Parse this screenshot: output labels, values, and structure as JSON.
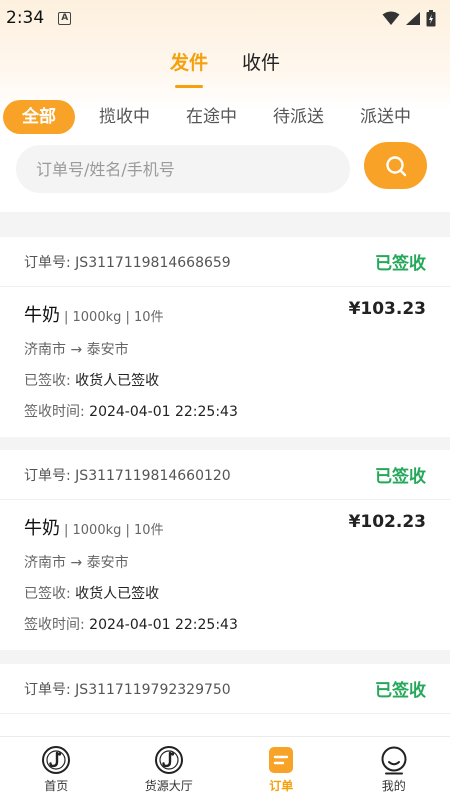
{
  "status_bar": {
    "time": "2:34",
    "notification_icon": "a-icon",
    "icons": [
      "wifi-icon",
      "signal-icon",
      "battery-icon"
    ]
  },
  "top_tabs": [
    {
      "label": "发件",
      "active": true
    },
    {
      "label": "收件",
      "active": false
    }
  ],
  "filters": [
    {
      "label": "全部",
      "active": true
    },
    {
      "label": "揽收中",
      "active": false
    },
    {
      "label": "在途中",
      "active": false
    },
    {
      "label": "待派送",
      "active": false
    },
    {
      "label": "派送中",
      "active": false
    }
  ],
  "search": {
    "placeholder": "订单号/姓名/手机号",
    "value": "",
    "button_icon": "search-icon"
  },
  "orders": [
    {
      "order_label": "订单号:",
      "order_no": "JS3117119814668659",
      "status": "已签收",
      "goods": "牛奶",
      "meta": "| 1000kg | 10件",
      "price": "¥103.23",
      "route": "济南市 → 泰安市",
      "sign_label": "已签收:",
      "sign_value": "收货人已签收",
      "time_label": "签收时间:",
      "time_value": "2024-04-01 22:25:43"
    },
    {
      "order_label": "订单号:",
      "order_no": "JS3117119814660120",
      "status": "已签收",
      "goods": "牛奶",
      "meta": "| 1000kg | 10件",
      "price": "¥102.23",
      "route": "济南市 → 泰安市",
      "sign_label": "已签收:",
      "sign_value": "收货人已签收",
      "time_label": "签收时间:",
      "time_value": "2024-04-01 22:25:43"
    },
    {
      "order_label": "订单号:",
      "order_no": "JS3117119792329750",
      "status": "已签收"
    }
  ],
  "bottom_nav": [
    {
      "label": "首页",
      "icon": "home-logo-icon",
      "active": false
    },
    {
      "label": "货源大厅",
      "icon": "cargo-hall-logo-icon",
      "active": false
    },
    {
      "label": "订单",
      "icon": "order-icon",
      "active": true
    },
    {
      "label": "我的",
      "icon": "profile-icon",
      "active": false
    }
  ],
  "colors": {
    "accent": "#f8a327",
    "accent_text": "#f5a00c",
    "status_green": "#25a85a"
  }
}
